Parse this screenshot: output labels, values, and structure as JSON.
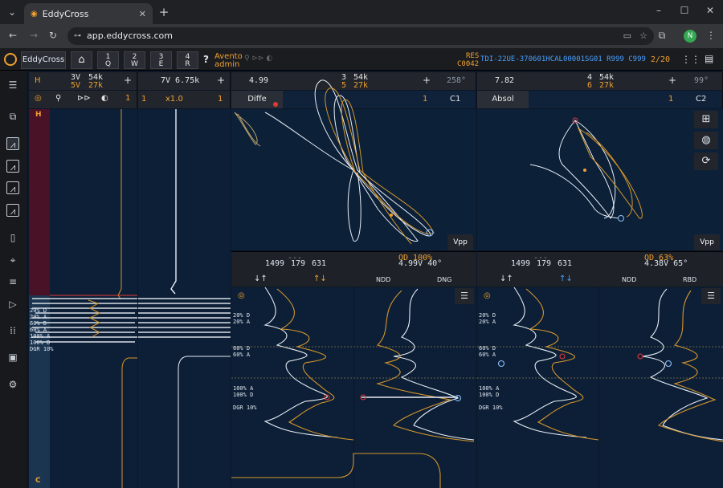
{
  "browser": {
    "tab_title": "EddyCross",
    "url": "app.eddycross.com",
    "profile_initial": "N"
  },
  "topbar": {
    "app_name": "EddyCross",
    "keys": [
      {
        "num": "1",
        "letter": "Q"
      },
      {
        "num": "2",
        "letter": "W"
      },
      {
        "num": "3",
        "letter": "E"
      },
      {
        "num": "4",
        "letter": "R"
      }
    ],
    "help": "?",
    "user_line1": "Avento",
    "user_line2": "admin",
    "res_label": "RES",
    "res_code": "C0042",
    "record_id": "TDI-22UE-370601HCAL00001SG01 R999 C999",
    "page": "2/20"
  },
  "panel1": {
    "h": "H",
    "ch_top": "3V",
    "ch_bot": "5V",
    "freq_top": "54k",
    "freq_bot": "27k",
    "plus": "+",
    "step": "1",
    "strip_top": "H",
    "strip_bottom": "C",
    "labels": [
      "20% D",
      "20% A",
      "60% D",
      "60% A",
      "100% A",
      "100% D",
      "DGR 10%"
    ]
  },
  "panel2": {
    "value": "7V 6.75k",
    "plus": "+",
    "zoom": "x1.0",
    "step_left": "1",
    "step_right": "1"
  },
  "lissa1": {
    "value": "4.99",
    "mode": "Diffe",
    "ch_top": "3",
    "ch_bot": "5",
    "freq_top": "54k",
    "freq_bot": "27k",
    "plus": "+",
    "angle": "258°",
    "step": "1",
    "chan": "C1",
    "vpp": "Vpp",
    "dashes": "---",
    "nums": [
      "1499",
      "179",
      "631"
    ],
    "od": "OD 100%",
    "reading": "4.99V  40°",
    "ndd": "NDD",
    "dng": "DNG",
    "labels": [
      "20% D",
      "20% A",
      "60% D",
      "60% A",
      "100% A",
      "100% D",
      "DGR 10%"
    ]
  },
  "lissa2": {
    "value": "7.82",
    "mode": "Absol",
    "ch_top": "4",
    "ch_bot": "6",
    "freq_top": "54k",
    "freq_bot": "27k",
    "plus": "+",
    "angle": "99°",
    "step": "1",
    "chan": "C2",
    "vpp": "Vpp",
    "dashes": "---",
    "nums": [
      "1499",
      "179",
      "631"
    ],
    "od": "OD  63%",
    "reading": "4.38V  65°",
    "ndd": "NDD",
    "rbd": "RBD",
    "labels": [
      "20% D",
      "20% A",
      "60% D",
      "60% A",
      "100% A",
      "100% D",
      "DGR 10%"
    ]
  },
  "colors": {
    "accent": "#f0a030",
    "blue": "#4aa0ff",
    "plot_bg": "#0c2038",
    "trace_white": "#e8eef6",
    "trace_orange": "#d6962c",
    "marker_red": "#e23838"
  },
  "icons": [
    "home-icon",
    "pin-icon",
    "fast-forward-icon",
    "palette-icon",
    "grid-icon",
    "globe-icon",
    "refresh-icon",
    "list-icon",
    "target-icon",
    "menu-icon"
  ]
}
